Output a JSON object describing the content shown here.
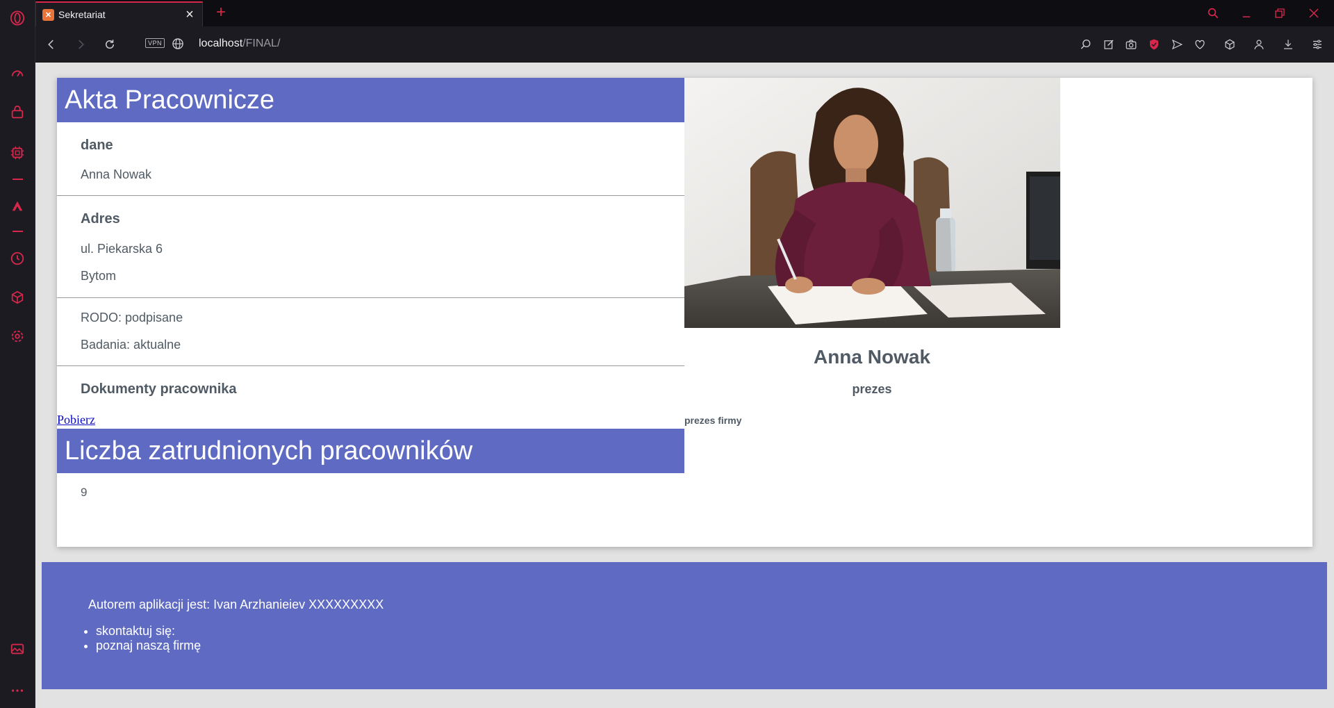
{
  "browser": {
    "tab_title": "Sekretariat",
    "tab_favicon": "xampp-icon",
    "url_host": "localhost",
    "url_path": "/FINAL/",
    "vpn_label": "VPN",
    "accent": "#d7274b"
  },
  "sidebar": {
    "icons": [
      "opera-logo-icon",
      "speed-dial-icon",
      "shopping-bag-icon",
      "chip-icon",
      "aria-icon",
      "history-icon",
      "cube-icon",
      "settings-icon",
      "gallery-icon",
      "more-icon"
    ]
  },
  "page": {
    "accent_color": "#5f6bc3",
    "header_title": "Akta Pracownicze",
    "dane": {
      "heading": "dane",
      "name": "Anna Nowak"
    },
    "adres": {
      "heading": "Adres",
      "street": "ul. Piekarska 6",
      "city": "Bytom"
    },
    "status": {
      "rodo": "RODO: podpisane",
      "badania": "Badania: aktualne"
    },
    "documents": {
      "heading": "Dokumenty pracownika",
      "link": "Pobierz"
    },
    "employees": {
      "title": "Liczba zatrudnionych pracowników",
      "count": "9"
    },
    "profile": {
      "name": "Anna Nowak",
      "role": "prezes",
      "description": "prezes firmy"
    }
  },
  "footer": {
    "author": "Autorem aplikacji jest: Ivan Arzhanieiev XXXXXXXXX",
    "links": [
      "skontaktuj się:",
      "poznaj naszą firmę"
    ]
  }
}
